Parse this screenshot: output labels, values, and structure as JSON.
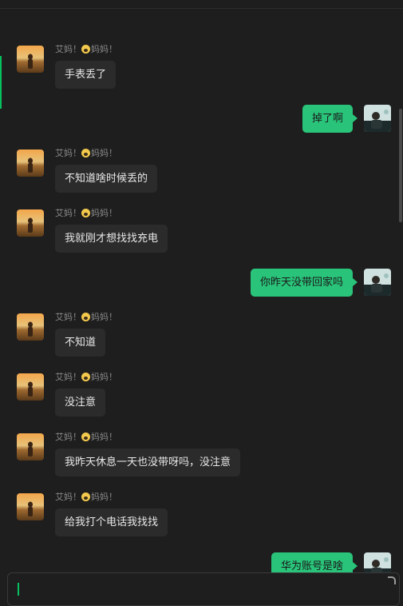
{
  "messages": [
    {
      "dir": "in",
      "sender": "艾妈！",
      "sender2": "妈妈！",
      "text": "手表丢了"
    },
    {
      "dir": "out",
      "text": "掉了啊"
    },
    {
      "dir": "in",
      "sender": "艾妈！",
      "sender2": "妈妈！",
      "text": "不知道啥时候丢的"
    },
    {
      "dir": "in",
      "sender": "艾妈！",
      "sender2": "妈妈！",
      "text": "我就刚才想找找充电"
    },
    {
      "dir": "out",
      "text": "你昨天没带回家吗"
    },
    {
      "dir": "in",
      "sender": "艾妈！",
      "sender2": "妈妈！",
      "text": "不知道"
    },
    {
      "dir": "in",
      "sender": "艾妈！",
      "sender2": "妈妈！",
      "text": "没注意"
    },
    {
      "dir": "in",
      "sender": "艾妈！",
      "sender2": "妈妈！",
      "text": "我昨天休息一天也没带呀吗，没注意"
    },
    {
      "dir": "in",
      "sender": "艾妈！",
      "sender2": "妈妈！",
      "text": "给我打个电话我找找"
    },
    {
      "dir": "out",
      "text": "华为账号是啥"
    }
  ],
  "icons": {
    "emoji": "scared-face-icon",
    "accent": "#07c160",
    "bubble_out": "#29c47a"
  }
}
